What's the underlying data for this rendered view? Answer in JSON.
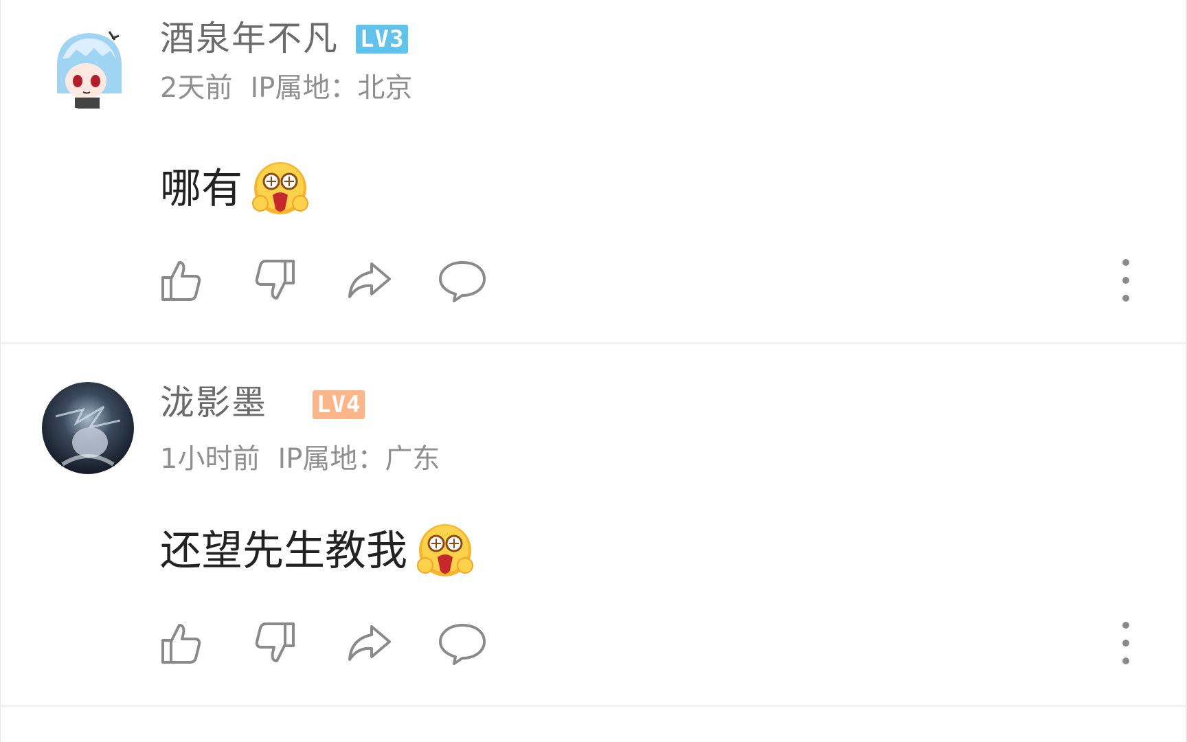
{
  "comments": [
    {
      "username": "酒泉年不凡",
      "level": "LV3",
      "level_color": "#5fc3ec",
      "time": "2天前",
      "ip_label": "IP属地：北京",
      "text": "哪有",
      "emoji": "shocked-emoji"
    },
    {
      "username": "泷影墨",
      "level": "LV4",
      "level_color": "#fdb68a",
      "time": "1小时前",
      "ip_label": "IP属地：广东",
      "text": "还望先生教我",
      "emoji": "shocked-emoji"
    }
  ],
  "colors": {
    "username": "#6b6b6b",
    "meta": "#8f8f8f",
    "content": "#222222",
    "icon": "#8a8a8a"
  },
  "icons": [
    "like-icon",
    "dislike-icon",
    "share-icon",
    "reply-icon",
    "more-icon"
  ]
}
